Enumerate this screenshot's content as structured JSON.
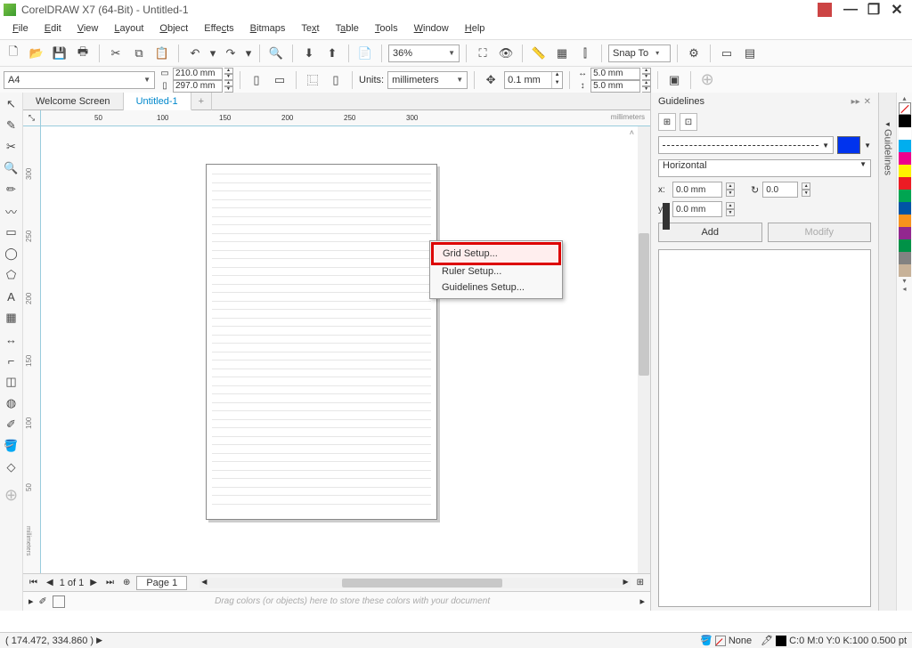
{
  "title": "CorelDRAW X7 (64-Bit) - Untitled-1",
  "menus": [
    "File",
    "Edit",
    "View",
    "Layout",
    "Object",
    "Effects",
    "Bitmaps",
    "Text",
    "Table",
    "Tools",
    "Window",
    "Help"
  ],
  "toolbar1": {
    "zoom": "36%",
    "snap": "Snap To"
  },
  "toolbar2": {
    "page_preset": "A4",
    "width": "210.0 mm",
    "height": "297.0 mm",
    "units_label": "Units:",
    "units": "millimeters",
    "nudge": "0.1 mm",
    "dup_x": "5.0 mm",
    "dup_y": "5.0 mm"
  },
  "doctabs": {
    "welcome": "Welcome Screen",
    "doc": "Untitled-1"
  },
  "ruler": {
    "unit_label": "millimeters",
    "ticks_h": [
      "50",
      "100",
      "150",
      "200",
      "250",
      "300"
    ],
    "ticks_v": [
      "300",
      "250",
      "200",
      "150",
      "100",
      "50"
    ]
  },
  "context_menu": {
    "grid": "Grid Setup...",
    "ruler": "Ruler Setup...",
    "guidelines": "Guidelines Setup..."
  },
  "pagebar": {
    "count": "1 of 1",
    "page_label": "Page 1"
  },
  "colortray_hint": "Drag colors (or objects) here to store these colors with your document",
  "guidelines": {
    "title": "Guidelines",
    "direction": "Horizontal",
    "x_label": "x:",
    "x": "0.0 mm",
    "y_label": "y:",
    "y": "0.0 mm",
    "rot": "0.0",
    "add": "Add",
    "modify": "Modify",
    "side_tab": "Guidelines"
  },
  "palette": [
    "#000000",
    "#ffffff",
    "#00aeef",
    "#ed008c",
    "#fff200",
    "#ec1c24",
    "#00a551",
    "#0054a5",
    "#f7931d",
    "#92278f",
    "#009247",
    "#828282",
    "#c7b299"
  ],
  "status": {
    "coords": "( 174.472, 334.860 )",
    "fill_label": "None",
    "cmyk": "C:0 M:0 Y:0 K:100 0.500 pt"
  }
}
